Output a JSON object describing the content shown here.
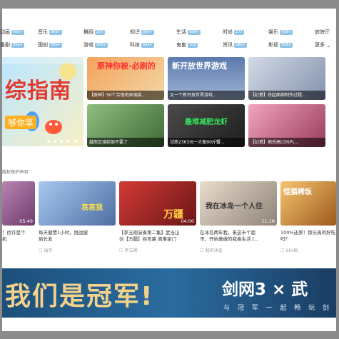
{
  "categories": [
    {
      "label": "动画",
      "badge": "999+"
    },
    {
      "label": "音乐",
      "badge": "999+"
    },
    {
      "label": "舞蹈",
      "badge": "257"
    },
    {
      "label": "知识",
      "badge": "999+"
    },
    {
      "label": "生活",
      "badge": "999+"
    },
    {
      "label": "时尚",
      "badge": "177"
    },
    {
      "label": "娱乐",
      "badge": "999+"
    },
    {
      "label": "放映厅",
      "badge": ""
    },
    {
      "label": "番剧",
      "badge": "999+"
    },
    {
      "label": "国创",
      "badge": "999+"
    },
    {
      "label": "游戏",
      "badge": "999+"
    },
    {
      "label": "科技",
      "badge": "999+"
    },
    {
      "label": "鬼畜",
      "badge": "108"
    },
    {
      "label": "资讯",
      "badge": "999+"
    },
    {
      "label": "影视",
      "badge": "999+"
    },
    {
      "label": "更多",
      "badge": ""
    }
  ],
  "banner": {
    "title": "综指南",
    "subtitle": "够你享"
  },
  "featured": [
    {
      "title": "【原神】50个合他奇异抽奖...",
      "big_text": "原神你被-必刷的",
      "color": "#f07e3a"
    },
    {
      "title": "又一个新开放世界游戏...",
      "big_text": "新开放世界游戏",
      "color": "#6a8dbd"
    },
    {
      "title": "【幻塔】白起面部制作过程...",
      "big_text": "",
      "color": "#a8b3c7"
    },
    {
      "title": "越南足球脸部不要了",
      "big_text": "",
      "color": "#6c8f5c"
    },
    {
      "title": "试炼2363元一大瓶90斤蟹...",
      "big_text": "最难减肥龙虾",
      "color": "#3b3b3b"
    },
    {
      "title": "【幻塔】地乐高COSPL...",
      "big_text": "",
      "color": "#c7688b"
    }
  ],
  "section_label": "版权保护声明",
  "videos": [
    {
      "title": "！仿许是个",
      "title2": "机",
      "author": "",
      "duration": "05:49",
      "thumb_text": ""
    },
    {
      "title": "每天健惯1小时，挑战披",
      "title2": "肩长发",
      "author": "瑞字",
      "duration": "",
      "thumb_text": "哀哀我"
    },
    {
      "title": "【李玉刚演奏第二集】武当山",
      "title2": "剑【万疆】拐弯路 周事家门",
      "author": "李玉刚",
      "duration": "04:00",
      "thumb_text": "万疆"
    },
    {
      "title": "在冰岛两年我，来这半个超",
      "title2": "市，开始做做的我奏生活 [...",
      "author": "我的冰岛",
      "duration": "11:18",
      "thumb_text": "我在冰岛一个人住"
    },
    {
      "title": "100%还原！惊乐真的好吃",
      "title2": "吗？",
      "author": "Shil麻",
      "duration": "",
      "thumb_text": "怪猫稀饭"
    }
  ],
  "ad": {
    "left_text": "我们是冠军!",
    "right_text": "剑网3 × 武",
    "slogan": "与 冠 军 一 起 畅 玩 剑"
  },
  "colors": {
    "badge": "#8fc3e6",
    "frame": "#8c8c8c",
    "ad_bg": "#1c4f7a"
  }
}
